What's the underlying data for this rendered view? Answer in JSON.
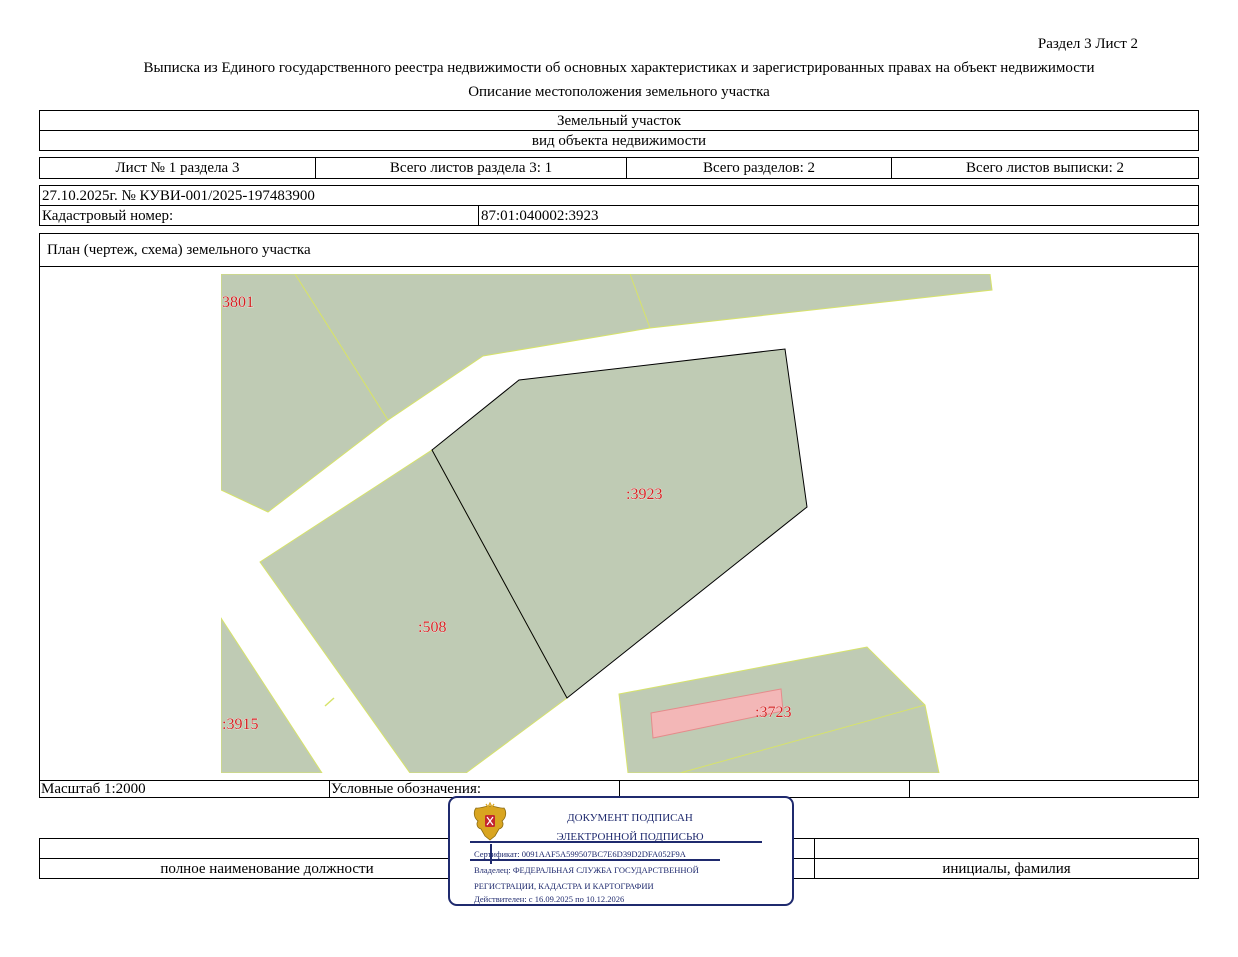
{
  "header": {
    "section_sheet": "Раздел 3    Лист 2",
    "title": "Выписка из Единого государственного реестра недвижимости об основных характеристиках и зарегистрированных правах на объект недвижимости",
    "subtitle": "Описание местоположения земельного участка"
  },
  "object": {
    "type": "Земельный участок",
    "type_caption": "вид объекта недвижимости"
  },
  "sheets": {
    "sheet_no": "Лист № 1 раздела 3",
    "total_section_sheets": "Всего листов раздела 3: 1",
    "total_sections": "Всего разделов: 2",
    "total_extract_sheets": "Всего листов выписки: 2"
  },
  "record": {
    "date_number": "27.10.2025г. № КУВИ-001/2025-197483900",
    "cadastral_label": "Кадастровый номер:",
    "cadastral_value": "87:01:040002:3923"
  },
  "plan": {
    "heading": "План (чертеж, схема) земельного участка",
    "labels": {
      "p3801": "3801",
      "p3923": ":3923",
      "p508": ":508",
      "p3915": ":3915",
      "p3723": ":3723"
    }
  },
  "legend": {
    "scale": "Масштаб 1:2000",
    "conventions": "Условные обозначения:"
  },
  "signature": {
    "position_caption": "полное наименование должности",
    "name_caption": "инициалы, фамилия"
  },
  "stamp": {
    "line1": "ДОКУМЕНТ ПОДПИСАН",
    "line2": "ЭЛЕКТРОННОЙ ПОДПИСЬЮ",
    "certificate": "Сертификат: 0091AAF5A599507BC7E6D39D2DFA052F9A",
    "owner_line1": "Владелец: ФЕДЕРАЛЬНАЯ СЛУЖБА ГОСУДАРСТВЕННОЙ",
    "owner_line2": "РЕГИСТРАЦИИ, КАДАСТРА И КАРТОГРАФИИ",
    "validity": "Действителен: с 16.09.2025 по 10.12.2026"
  },
  "colors": {
    "parcel_fill": "#bfcbb4",
    "parcel_edge": "#d7e36a",
    "label_red": "#d42020",
    "building_fill": "#f3b7b7",
    "stamp_border": "#1f2a6e"
  }
}
